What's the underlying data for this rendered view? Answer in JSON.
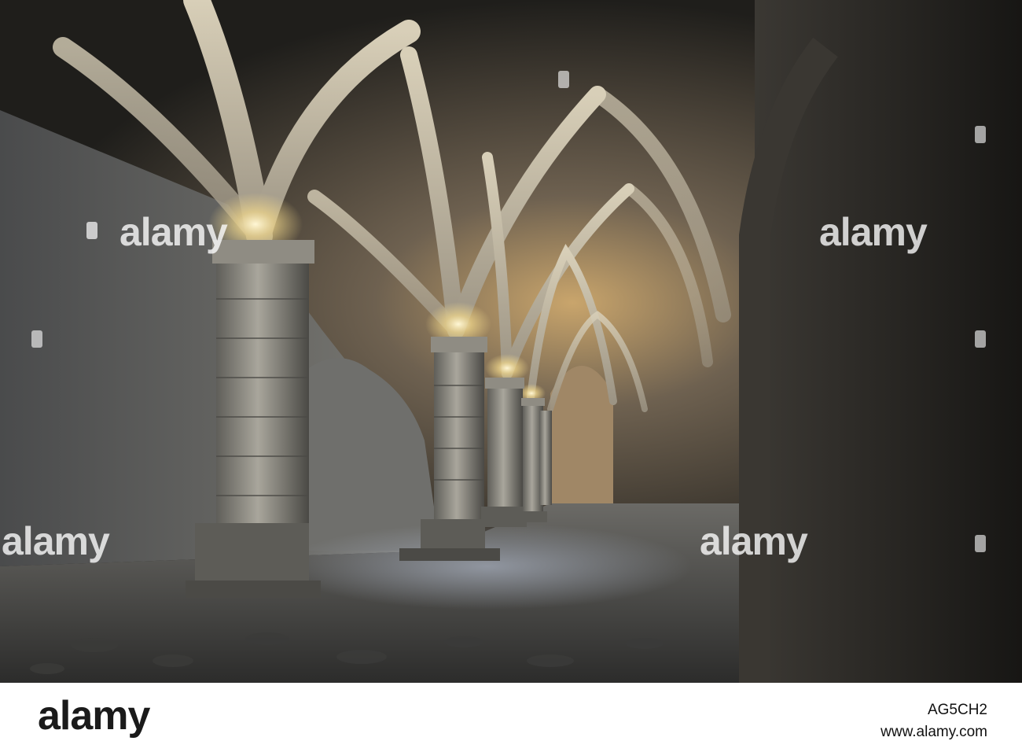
{
  "photo": {
    "subject": "vaulted-stone-undercroft",
    "colors": {
      "shadow": "#1f1e1b",
      "stone": "#8d8a80",
      "warm_light": "#d9b77a",
      "floor": "#5a5a58"
    }
  },
  "watermark": {
    "text": "alamy"
  },
  "footer": {
    "brand": "alamy",
    "image_id": "AG5CH2",
    "url": "www.alamy.com"
  }
}
